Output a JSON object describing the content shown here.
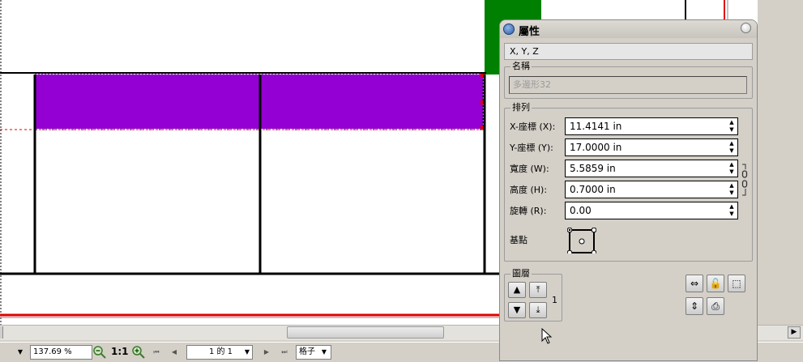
{
  "panel": {
    "title": "屬性",
    "xyz_tab": "X, Y, Z",
    "name_group_label": "名稱",
    "name_value": "多邊形32",
    "arrange_group_label": "排列",
    "fields": [
      {
        "label": "X-座標 (X):",
        "value": "11.4141 in"
      },
      {
        "label": "Y-座標 (Y):",
        "value": "17.0000 in"
      },
      {
        "label": "寬度 (W):",
        "value": "5.5859 in"
      },
      {
        "label": "高度 (H):",
        "value": "0.7000 in"
      },
      {
        "label": "旋轉 (R):",
        "value": "0.00"
      }
    ],
    "basis_label": "基點",
    "layer_group_label": "圖層",
    "layer_value": "1"
  },
  "statusbar": {
    "zoom": "137.69 %",
    "zoom_one": "1:1",
    "page": "1 的 1",
    "unit": "格子"
  },
  "colors": {
    "selected_shape": "#9400d3",
    "green_block": "#008000",
    "guide_red": "#e00000"
  },
  "icons": {
    "zoom_out": "magnifier-minus-icon",
    "zoom_in": "magnifier-plus-icon",
    "first_page": "first-page-icon",
    "prev_page": "prev-page-icon",
    "next_page": "next-page-icon",
    "last_page": "last-page-icon"
  }
}
